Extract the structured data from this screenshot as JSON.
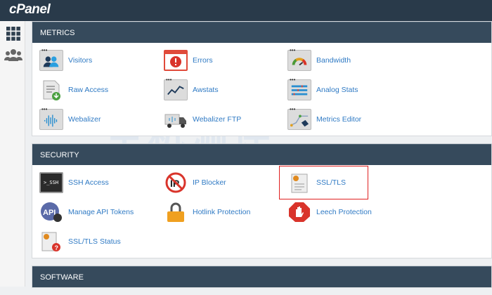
{
  "app": {
    "logo": "cPanel"
  },
  "sidebar": [
    {
      "icon": "grid-icon"
    },
    {
      "icon": "users-icon"
    }
  ],
  "sections": [
    {
      "title": "METRICS",
      "items": [
        {
          "label": "Visitors",
          "icon": "visitors-icon"
        },
        {
          "label": "Errors",
          "icon": "errors-icon"
        },
        {
          "label": "Bandwidth",
          "icon": "bandwidth-icon"
        },
        {
          "label": "Raw Access",
          "icon": "raw-access-icon"
        },
        {
          "label": "Awstats",
          "icon": "awstats-icon"
        },
        {
          "label": "Analog Stats",
          "icon": "analog-stats-icon"
        },
        {
          "label": "Webalizer",
          "icon": "webalizer-icon"
        },
        {
          "label": "Webalizer FTP",
          "icon": "webalizer-ftp-icon"
        },
        {
          "label": "Metrics Editor",
          "icon": "metrics-editor-icon"
        }
      ]
    },
    {
      "title": "SECURITY",
      "items": [
        {
          "label": "SSH Access",
          "icon": "ssh-icon"
        },
        {
          "label": "IP Blocker",
          "icon": "ip-blocker-icon"
        },
        {
          "label": "SSL/TLS",
          "icon": "ssl-certificate-icon"
        },
        {
          "label": "Manage API Tokens",
          "icon": "api-icon"
        },
        {
          "label": "Hotlink Protection",
          "icon": "lock-icon"
        },
        {
          "label": "Leech Protection",
          "icon": "stop-hand-icon"
        },
        {
          "label": "SSL/TLS Status",
          "icon": "ssl-status-icon"
        }
      ]
    },
    {
      "title": "SOFTWARE",
      "items": []
    }
  ],
  "watermark": {
    "title": "主机测评",
    "subtitle": "服务跨境电商 助力中企出海"
  },
  "colors": {
    "topbar": "#293a4a",
    "section_header": "#364a5c",
    "link": "#2f7ac4",
    "highlight": "#e02020"
  }
}
